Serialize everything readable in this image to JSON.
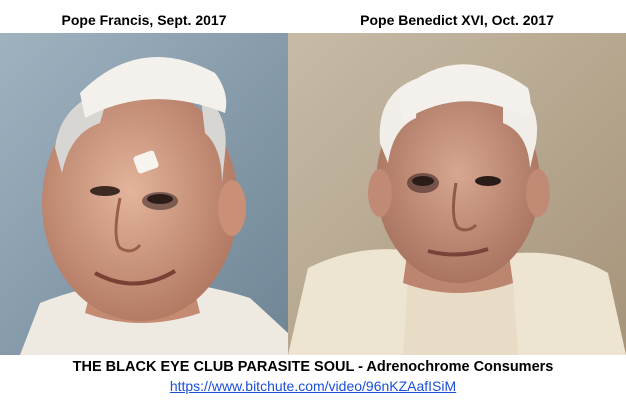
{
  "captions": {
    "left": "Pope Francis, Sept. 2017",
    "right": "Pope Benedict XVI, Oct. 2017"
  },
  "footer": {
    "title": "THE BLACK EYE CLUB PARASITE SOUL - Adrenochrome Consumers",
    "link": "https://www.bitchute.com/video/96nKZAafISiM"
  },
  "colors": {
    "left_background": "#8aa0b0",
    "right_background": "#b9aa93",
    "skin": "#d9a58c",
    "cap": "#f4f1ec",
    "link": "#1a4fd6"
  }
}
